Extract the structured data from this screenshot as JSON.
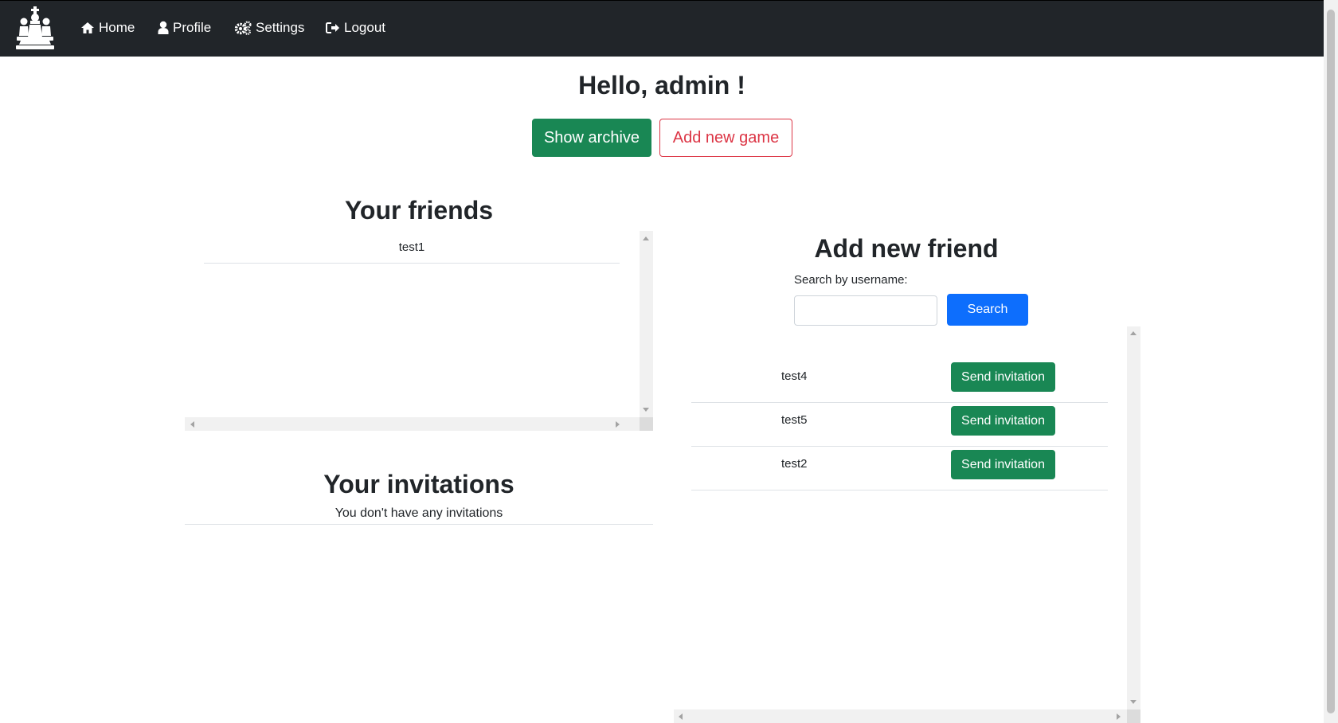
{
  "nav": {
    "logo": "chess-pieces-logo",
    "items": [
      {
        "label": "Home",
        "icon": "home-icon"
      },
      {
        "label": "Profile",
        "icon": "user-icon"
      },
      {
        "label": "Settings",
        "icon": "gears-icon"
      },
      {
        "label": "Logout",
        "icon": "logout-icon"
      }
    ]
  },
  "greeting": "Hello, admin !",
  "actions": {
    "show_archive": "Show archive",
    "add_new_game": "Add new game"
  },
  "friends": {
    "title": "Your friends",
    "list": [
      "test1"
    ]
  },
  "invitations": {
    "title": "Your invitations",
    "empty_message": "You don't have any invitations"
  },
  "add_friend": {
    "title": "Add new friend",
    "search_label": "Search by username:",
    "search_value": "",
    "search_button": "Search",
    "results": [
      {
        "username": "test4",
        "action": "Send invitation"
      },
      {
        "username": "test5",
        "action": "Send invitation"
      },
      {
        "username": "test2",
        "action": "Send invitation"
      }
    ]
  },
  "colors": {
    "navbar": "#212529",
    "success": "#198754",
    "danger": "#dc3545",
    "primary": "#0d6efd"
  }
}
